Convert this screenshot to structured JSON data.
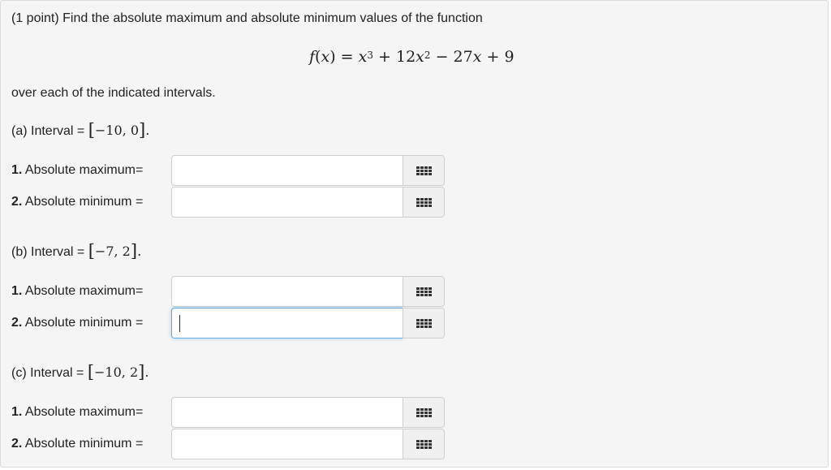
{
  "problem": {
    "intro": "(1 point) Find the absolute maximum and absolute minimum values of the function",
    "formula": {
      "lhs_f": "f",
      "lhs_var": "x",
      "equals": "=",
      "t1_var": "x",
      "t1_exp": "3",
      "plus1": "+",
      "t2_coef": "12",
      "t2_var": "x",
      "t2_exp": "2",
      "minus": "−",
      "t3_coef": "27",
      "t3_var": "x",
      "plus2": "+",
      "const": "9"
    },
    "over_text": "over each of the indicated intervals."
  },
  "parts": [
    {
      "label": "(a) Interval =",
      "interval": "−10, 0",
      "rows": [
        {
          "num": "1.",
          "label": "Absolute maximum=",
          "value": ""
        },
        {
          "num": "2.",
          "label": "Absolute minimum =",
          "value": ""
        }
      ]
    },
    {
      "label": "(b) Interval =",
      "interval": "−7, 2",
      "rows": [
        {
          "num": "1.",
          "label": "Absolute maximum=",
          "value": ""
        },
        {
          "num": "2.",
          "label": "Absolute minimum =",
          "value": ""
        }
      ]
    },
    {
      "label": "(c) Interval =",
      "interval": "−10, 2",
      "rows": [
        {
          "num": "1.",
          "label": "Absolute maximum=",
          "value": ""
        },
        {
          "num": "2.",
          "label": "Absolute minimum =",
          "value": ""
        }
      ]
    }
  ],
  "icons": {
    "equation_editor": "grid-icon"
  },
  "colors": {
    "panel_bg": "#f5f5f5",
    "focus_border": "#66afe9"
  }
}
